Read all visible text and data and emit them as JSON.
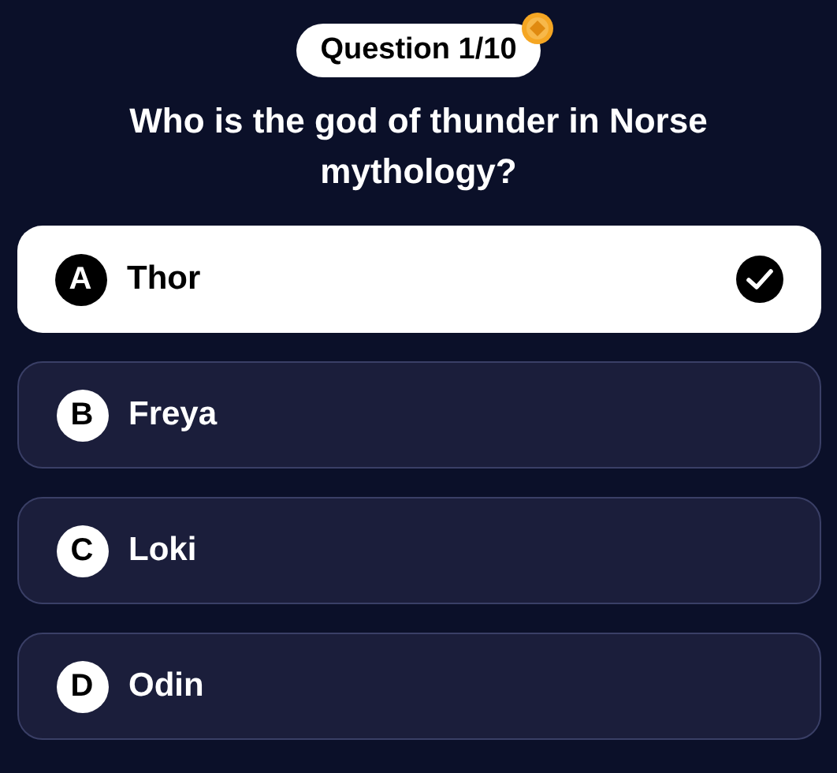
{
  "badge": {
    "label": "Question 1/10"
  },
  "question": "Who is the god of thunder in Norse mythology?",
  "options": [
    {
      "letter": "A",
      "label": "Thor",
      "selected": true
    },
    {
      "letter": "B",
      "label": "Freya",
      "selected": false
    },
    {
      "letter": "C",
      "label": "Loki",
      "selected": false
    },
    {
      "letter": "D",
      "label": "Odin",
      "selected": false
    }
  ]
}
